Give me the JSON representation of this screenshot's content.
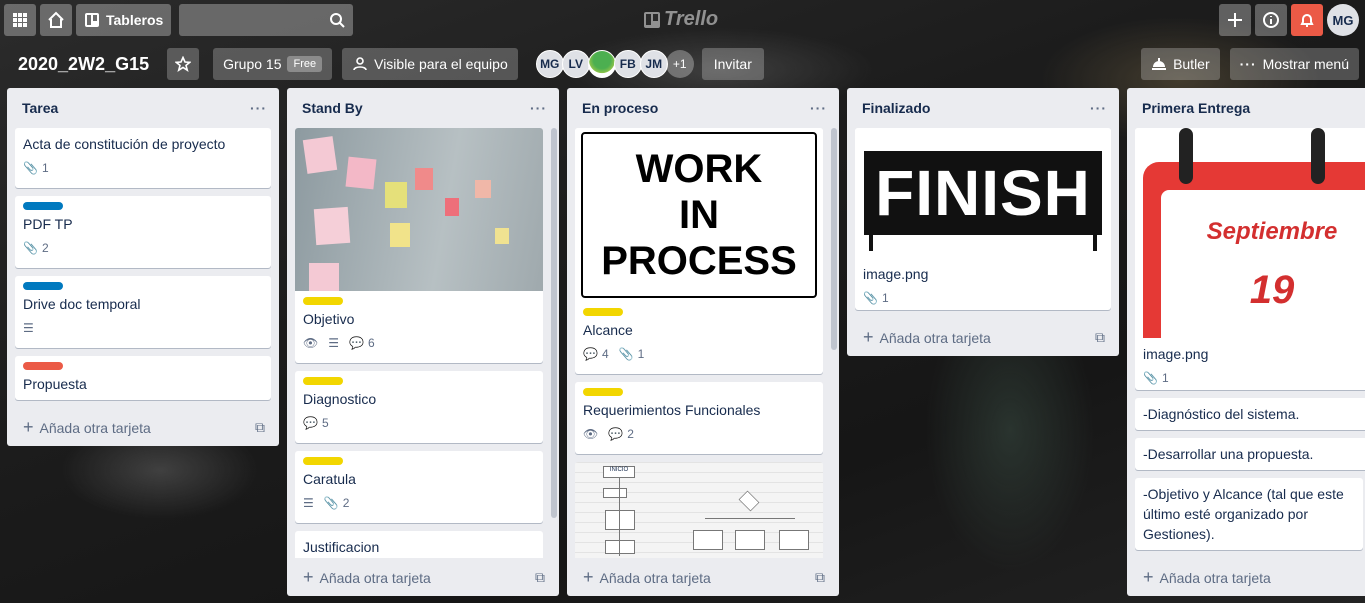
{
  "topbar": {
    "tableros": "Tableros",
    "logo": "Trello",
    "avatar": "MG"
  },
  "board": {
    "name": "2020_2W2_G15",
    "team": "Grupo 15",
    "team_badge": "Free",
    "visibility": "Visible para el equipo",
    "members": [
      "MG",
      "LV",
      "",
      "FB",
      "JM"
    ],
    "more_members": "+1",
    "invite": "Invitar",
    "butler": "Butler",
    "menu": "Mostrar menú"
  },
  "add_card": "Añada otra tarjeta",
  "lists": [
    {
      "title": "Tarea",
      "cards": [
        {
          "title": "Acta de constitución de proyecto",
          "attachments": "1"
        },
        {
          "label": "#0079bf",
          "title": "PDF TP",
          "attachments": "2"
        },
        {
          "label": "#0079bf",
          "title": "Drive doc temporal"
        },
        {
          "label": "#eb5a46",
          "title": "Propuesta"
        }
      ]
    },
    {
      "title": "Stand By",
      "cards": [
        {
          "label": "#f2d600",
          "title": "Objetivo",
          "comments": "6"
        },
        {
          "label": "#f2d600",
          "title": "Diagnostico",
          "comments": "5"
        },
        {
          "label": "#f2d600",
          "title": "Caratula",
          "attachments": "2"
        },
        {
          "title": "Justificacion"
        }
      ]
    },
    {
      "title": "En proceso",
      "cards": [
        {
          "cover_text": [
            "WORK",
            "IN",
            "PROCESS"
          ],
          "label": "#f2d600",
          "title": "Alcance",
          "comments": "4",
          "attachments": "1"
        },
        {
          "label": "#f2d600",
          "title": "Requerimientos Funcionales",
          "comments": "2"
        },
        {
          "cover_caption": "INICIO"
        }
      ]
    },
    {
      "title": "Finalizado",
      "cards": [
        {
          "cover_text": "FINISH",
          "title": "image.png",
          "attachments": "1"
        }
      ]
    },
    {
      "title": "Primera Entrega",
      "cards": [
        {
          "cover_month": "Septiembre",
          "cover_day": "19",
          "title": "image.png",
          "attachments": "1"
        },
        {
          "title": "-Diagnóstico del sistema."
        },
        {
          "title": "-Desarrollar una propuesta."
        },
        {
          "title": "-Objetivo y Alcance (tal que este último esté organizado por Gestiones)."
        }
      ]
    }
  ]
}
